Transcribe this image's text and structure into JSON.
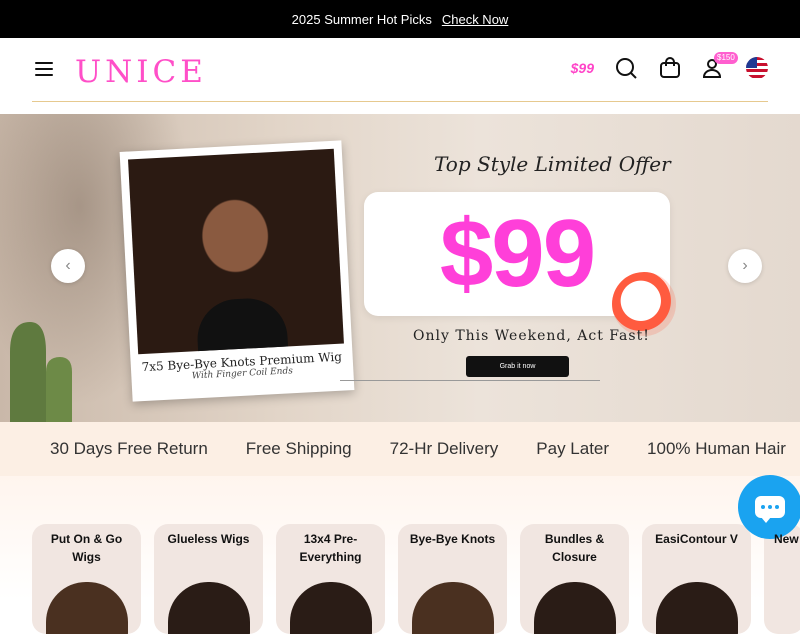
{
  "topbar": {
    "promo": "2025 Summer Hot Picks",
    "link": "Check Now"
  },
  "header": {
    "logo": "UNICE",
    "deal_label": "$99",
    "account_badge": "$150",
    "icons": [
      "menu-icon",
      "deal-99-icon",
      "search-icon",
      "bag-icon",
      "user-icon",
      "us-flag-icon"
    ]
  },
  "hero": {
    "product_title": "7x5 Bye-Bye Knots Premium Wig",
    "product_subtitle": "With Finger Coil Ends",
    "offer_title": "Top Style Limited Offer",
    "price": "$99",
    "tagline": "Only This Weekend, Act Fast!",
    "cta": "Grab it now",
    "prev_arrow": "‹",
    "next_arrow": "›"
  },
  "features": [
    "30 Days Free Return",
    "Free Shipping",
    "72-Hr Delivery",
    "Pay Later",
    "100% Human Hair"
  ],
  "categories": [
    {
      "label": "Put On & Go Wigs"
    },
    {
      "label": "Glueless Wigs"
    },
    {
      "label": "13x4 Pre-Everything"
    },
    {
      "label": "Bye-Bye Knots"
    },
    {
      "label": "Bundles & Closure"
    },
    {
      "label": "EasiContour V"
    },
    {
      "label": "New"
    }
  ],
  "colors": {
    "brand_pink": "#ff4fc8",
    "chat_blue": "#1aa3f0",
    "feature_bg": "#fcefe4"
  }
}
